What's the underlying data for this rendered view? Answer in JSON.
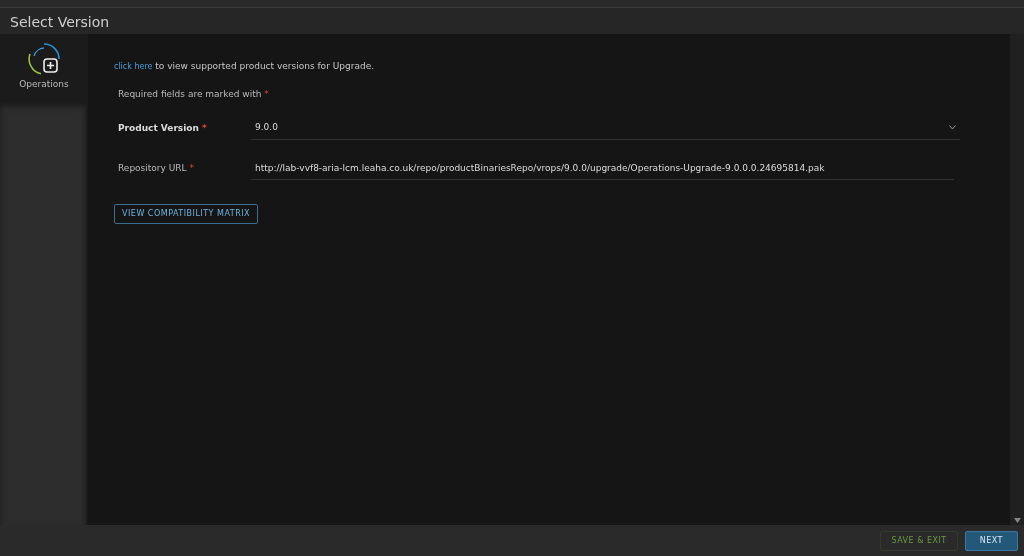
{
  "window": {
    "title": "Select Version"
  },
  "sidebar": {
    "items": [
      {
        "label": "Operations",
        "selected": true
      }
    ]
  },
  "intro": {
    "link": "click here",
    "text": "to view supported product versions for Upgrade."
  },
  "required_note": {
    "text": "Required fields are marked with",
    "marker": "*"
  },
  "fields": [
    {
      "kind": "select",
      "label": "Product Version",
      "marker": "*",
      "value": "9.0.0"
    },
    {
      "kind": "text",
      "label": "Repository URL",
      "marker": "*",
      "value": "http://lab-vvf8-aria-lcm.leaha.co.uk/repo/productBinariesRepo/vrops/9.0.0/upgrade/Operations-Upgrade-9.0.0.0.24695814.pak"
    }
  ],
  "matrix_button": "VIEW COMPATIBILITY MATRIX",
  "footer": {
    "buttons": [
      {
        "label": "SAVE & EXIT",
        "kind": "secondary"
      },
      {
        "label": "NEXT",
        "kind": "primary"
      }
    ]
  }
}
